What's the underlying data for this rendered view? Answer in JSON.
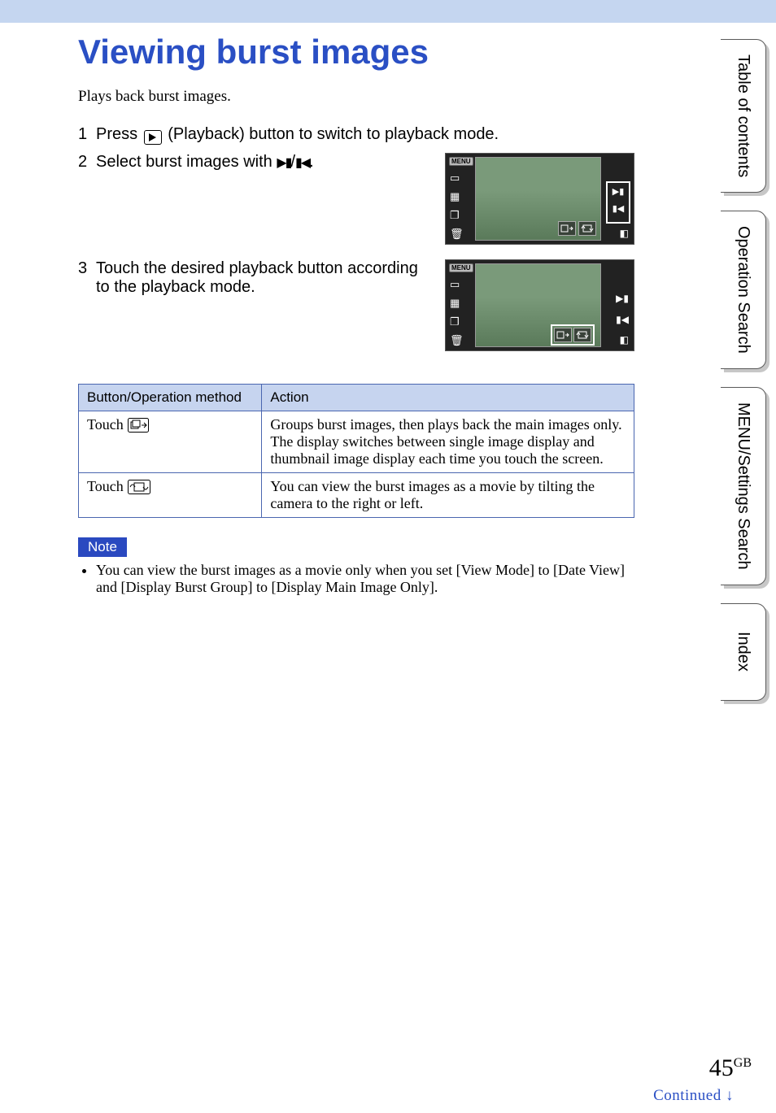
{
  "title": "Viewing burst images",
  "intro": "Plays back burst images.",
  "steps": [
    {
      "num": "1",
      "text_a": "Press ",
      "text_b": " (Playback) button to switch to playback mode."
    },
    {
      "num": "2",
      "text_a": "Select burst images with ",
      "text_b": "."
    },
    {
      "num": "3",
      "text_a": "Touch the desired playback button according to the playback mode.",
      "text_b": ""
    }
  ],
  "table": {
    "headers": [
      "Button/Operation method",
      "Action"
    ],
    "rows": [
      {
        "btn": "Touch ",
        "action": "Groups burst images, then plays back the main images only. The display switches between single image display and thumbnail image display each time you touch the screen."
      },
      {
        "btn": "Touch ",
        "action": "You can view the burst images as a movie by tilting the camera to the right or left."
      }
    ]
  },
  "note_label": "Note",
  "note_text": "You can view the burst images as a movie only when you set [View Mode] to [Date View] and [Display Burst Group] to [Display Main Image Only].",
  "tabs": [
    "Table of contents",
    "Operation Search",
    "MENU/Settings Search",
    "Index"
  ],
  "page_number": "45",
  "page_lang": "GB",
  "continued": "Continued",
  "thumb1_menu": "MENU",
  "thumb2_menu": "MENU"
}
